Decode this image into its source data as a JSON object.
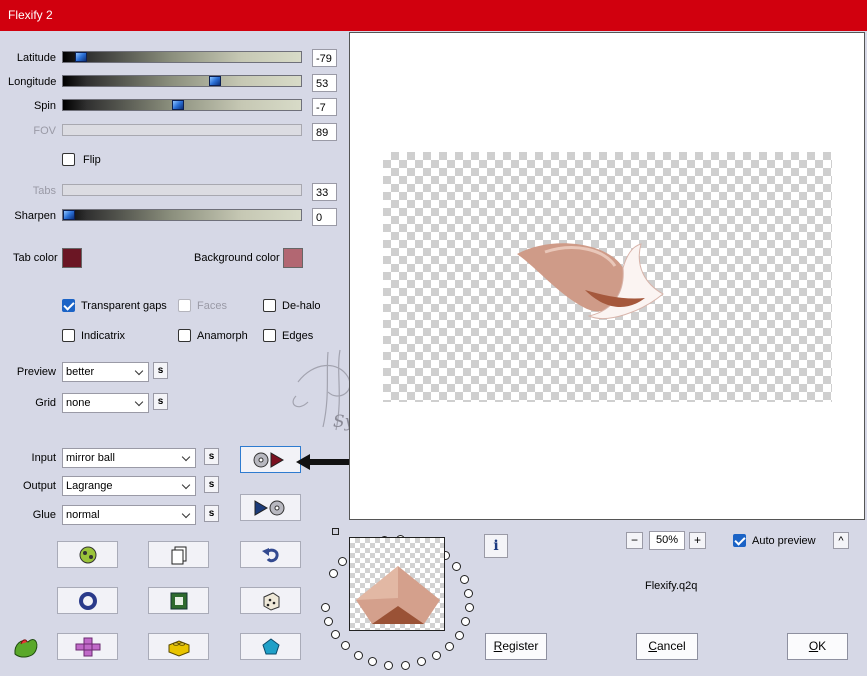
{
  "title": "Flexify 2",
  "sliders": [
    {
      "label": "Latitude",
      "value": "-79",
      "disabled": false
    },
    {
      "label": "Longitude",
      "value": "53",
      "disabled": false
    },
    {
      "label": "Spin",
      "value": "-7",
      "disabled": false
    },
    {
      "label": "FOV",
      "value": "89",
      "disabled": true
    },
    {
      "label": "Tabs",
      "value": "33",
      "disabled": true
    },
    {
      "label": "Sharpen",
      "value": "0",
      "disabled": false
    }
  ],
  "flip_label": "Flip",
  "tab_color": {
    "label": "Tab color",
    "value": "#6b1624"
  },
  "background_color": {
    "label": "Background color",
    "value": "#b26772"
  },
  "options": {
    "transparent_gaps": "Transparent gaps",
    "faces": "Faces",
    "de_halo": "De-halo",
    "indicatrix": "Indicatrix",
    "anamorph": "Anamorph",
    "edges": "Edges"
  },
  "preview": {
    "label": "Preview",
    "value": "better"
  },
  "grid": {
    "label": "Grid",
    "value": "none"
  },
  "input": {
    "label": "Input",
    "value": "mirror ball"
  },
  "output": {
    "label": "Output",
    "value": "Lagrange"
  },
  "glue": {
    "label": "Glue",
    "value": "normal"
  },
  "s_label": "s",
  "watermark": "Sylviane",
  "zoom": {
    "value": "50%",
    "minus": "−",
    "plus": "+"
  },
  "auto_preview": "Auto preview",
  "caret": "^",
  "info": "i",
  "filename": "Flexify.q2q",
  "register_label": {
    "u": "R",
    "rest": "egister"
  },
  "cancel_label": {
    "u": "C",
    "rest": "ancel"
  },
  "ok_label": {
    "u": "O",
    "rest": "K"
  },
  "colors": {
    "titlebar": "#d1000e",
    "accent": "#1b63c6",
    "dialog": "#d6d8e6"
  }
}
